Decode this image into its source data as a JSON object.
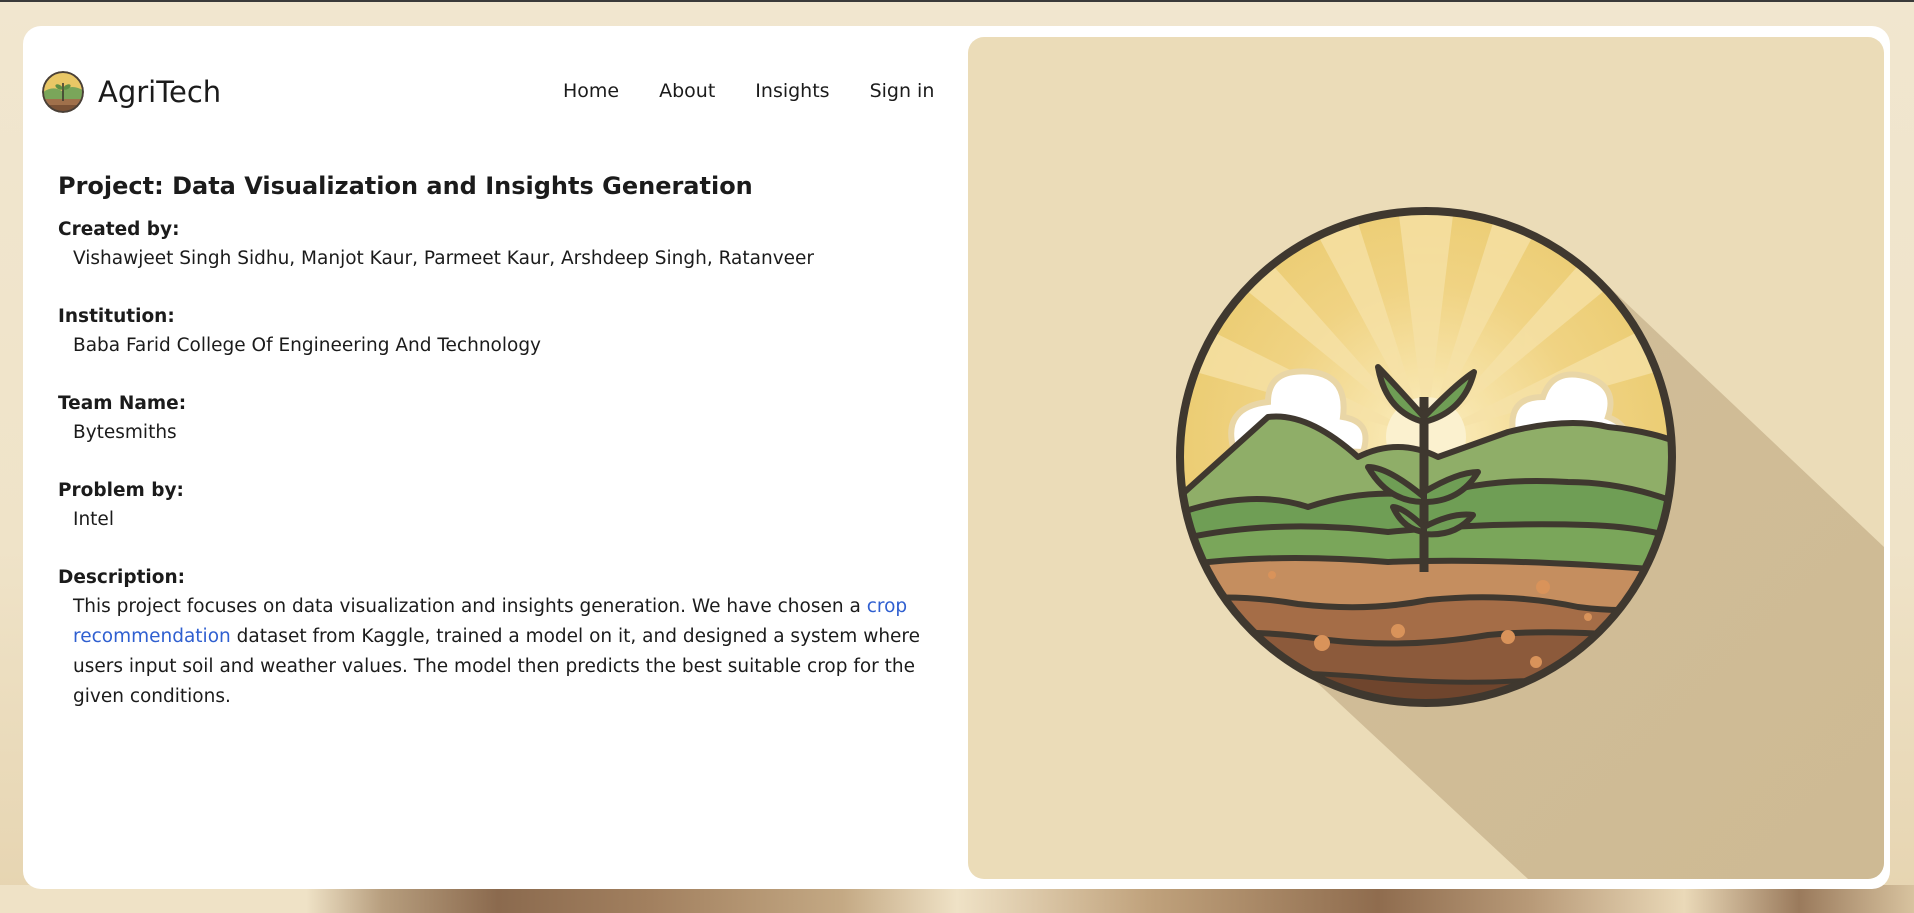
{
  "brand": {
    "name": "AgriTech"
  },
  "nav": {
    "items": [
      "Home",
      "About",
      "Insights",
      "Sign in"
    ]
  },
  "project": {
    "title": "Project: Data Visualization and Insights Generation",
    "created_by_label": "Created by:",
    "created_by": "Vishawjeet Singh Sidhu, Manjot Kaur, Parmeet Kaur, Arshdeep Singh, Ratanveer",
    "institution_label": "Institution:",
    "institution": "Baba Farid College Of Engineering And Technology",
    "team_label": "Team Name:",
    "team": "Bytesmiths",
    "problem_label": "Problem by:",
    "problem": "Intel",
    "description_label": "Description:",
    "description_part1": "This project focuses on data visualization and insights generation. We have chosen a ",
    "description_link": "crop recommendation",
    "description_part2": " dataset from Kaggle, trained a model on it, and designed a system where users input soil and weather values. The model then predicts the best suitable crop for the given conditions."
  },
  "colors": {
    "background": "#f1e6cf",
    "card": "#ffffff",
    "panel": "#ebdcb8",
    "link": "#2f5fd0",
    "text": "#1b1b1b"
  },
  "icons": {
    "logo": "agritech-logo-icon",
    "illustration": "sprouting-plant-landscape-illustration"
  }
}
